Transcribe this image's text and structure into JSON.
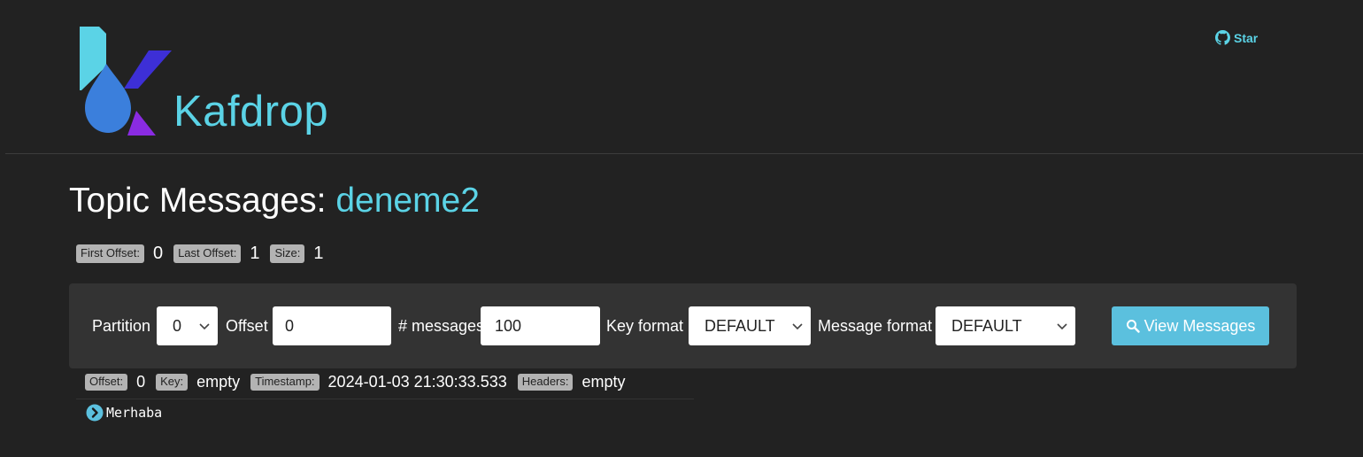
{
  "header": {
    "app_name": "Kafdrop",
    "star_label": "Star"
  },
  "title": {
    "prefix": "Topic Messages:",
    "topic": "deneme2"
  },
  "stats": {
    "first_offset_label": "First Offset:",
    "first_offset": "0",
    "last_offset_label": "Last Offset:",
    "last_offset": "1",
    "size_label": "Size:",
    "size": "1"
  },
  "filters": {
    "partition_label": "Partition",
    "partition_value": "0",
    "offset_label": "Offset",
    "offset_value": "0",
    "messages_label": "# messages",
    "messages_value": "100",
    "key_format_label": "Key format",
    "key_format_value": "DEFAULT",
    "message_format_label": "Message format",
    "message_format_value": "DEFAULT",
    "view_button_label": "View Messages"
  },
  "messages": [
    {
      "offset_label": "Offset:",
      "offset": "0",
      "key_label": "Key:",
      "key": "empty",
      "timestamp_label": "Timestamp:",
      "timestamp": "2024-01-03 21:30:33.533",
      "headers_label": "Headers:",
      "headers": "empty",
      "content": "Merhaba"
    }
  ],
  "colors": {
    "background": "#222222",
    "accent": "#5bd3e6",
    "button": "#5bc0de",
    "panel": "#333333",
    "badge": "#b3b3b3"
  },
  "icons": {
    "github": "github-icon",
    "search": "search-icon",
    "expand": "chevron-right-circle-icon",
    "select": "chevron-down-icon"
  }
}
